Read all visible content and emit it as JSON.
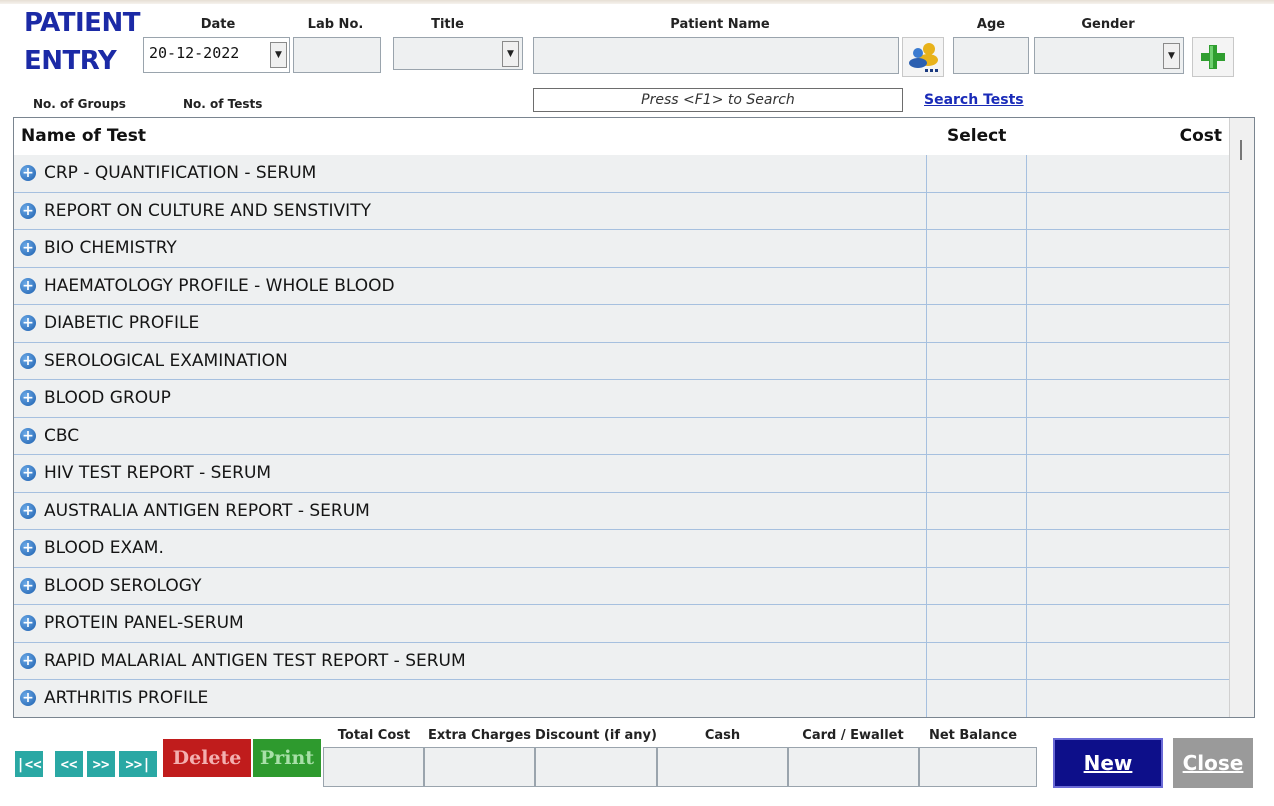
{
  "header": {
    "brand_line1": "PATIENT",
    "brand_line2": "ENTRY",
    "date_label": "Date",
    "date_value": "20-12-2022",
    "lab_no_label": "Lab No.",
    "title_label": "Title",
    "patient_name_label": "Patient Name",
    "age_label": "Age",
    "gender_label": "Gender",
    "groups_label": "No. of Groups",
    "tests_label": "No. of Tests",
    "search_placeholder": "Press <F1> to Search",
    "search_tests_link": "Search Tests"
  },
  "grid": {
    "columns": [
      "Name of Test",
      "Select",
      "Cost"
    ],
    "rows": [
      "CRP - QUANTIFICATION - SERUM",
      "REPORT ON CULTURE AND SENSTIVITY",
      "BIO CHEMISTRY",
      "HAEMATOLOGY PROFILE - WHOLE BLOOD",
      "DIABETIC PROFILE",
      "SEROLOGICAL EXAMINATION",
      "BLOOD GROUP",
      "CBC",
      "HIV TEST REPORT - SERUM",
      "AUSTRALIA ANTIGEN REPORT - SERUM",
      "BLOOD EXAM.",
      "BLOOD SEROLOGY",
      "PROTEIN PANEL-SERUM",
      "RAPID MALARIAL ANTIGEN TEST REPORT - SERUM",
      "ARTHRITIS PROFILE"
    ]
  },
  "footer": {
    "nav": [
      "|<<",
      "<<",
      ">>",
      ">>|"
    ],
    "delete_label": "Delete",
    "print_label": "Print",
    "totals_labels": [
      "Total Cost",
      "Extra Charges",
      "Discount (if any)",
      "Cash",
      "Card / Ewallet",
      "Net Balance"
    ],
    "new_label": "New",
    "close_label": "Close"
  },
  "icons": {
    "patient_lookup": "people-lookup-icon",
    "add": "green-plus-icon",
    "row_expand": "blue-plus-circle-icon"
  },
  "colors": {
    "brand": "#1b2aa6",
    "delete": "#c01c1c",
    "print": "#2e9a2e",
    "new": "#0d0f8a",
    "close": "#9a9a9a",
    "nav": "#2aa8a4"
  }
}
